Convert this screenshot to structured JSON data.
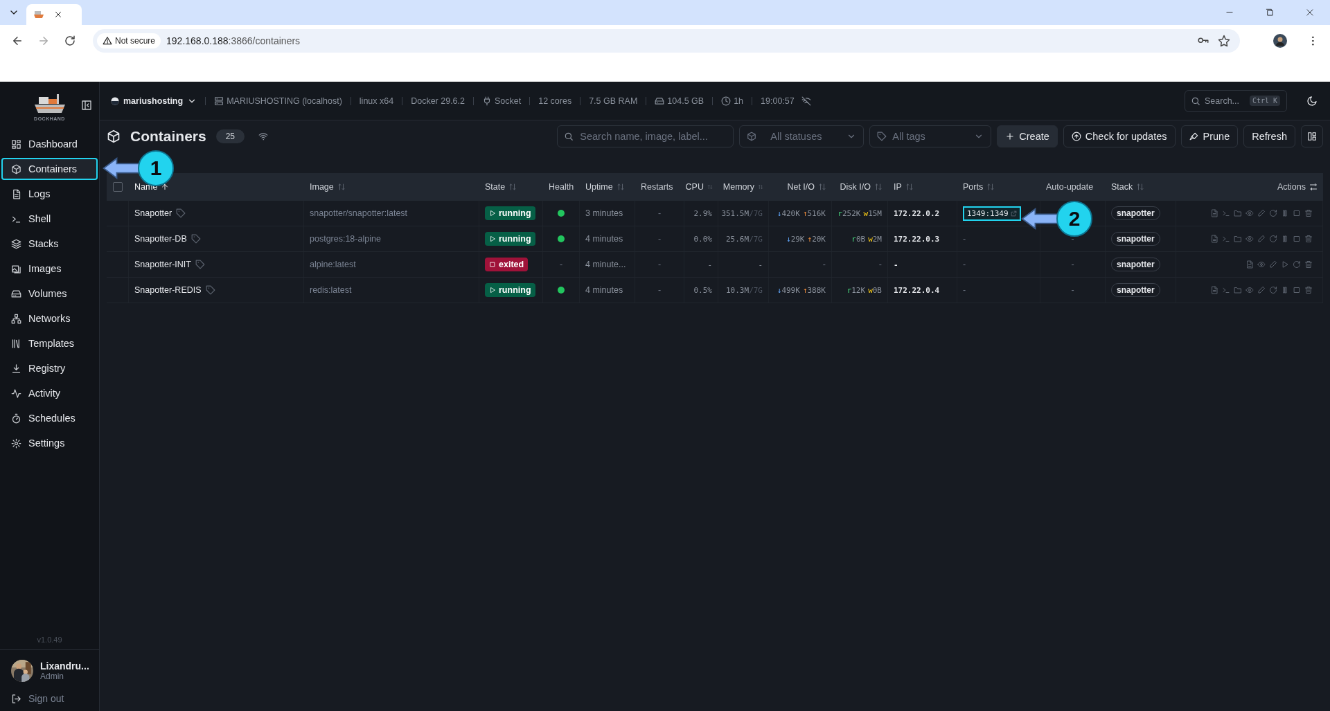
{
  "browser": {
    "tab": {
      "selected": true
    },
    "address": {
      "security": "Not secure",
      "host": "192.168.0.188",
      "path": ":3866/containers"
    }
  },
  "sidebar": {
    "logo_text": "DOCKHAND",
    "items": [
      {
        "label": "Dashboard",
        "kind": "dashboard",
        "selected": false
      },
      {
        "label": "Containers",
        "kind": "containers",
        "selected": true
      },
      {
        "label": "Logs",
        "kind": "logs",
        "selected": false
      },
      {
        "label": "Shell",
        "kind": "shell",
        "selected": false
      },
      {
        "label": "Stacks",
        "kind": "stacks",
        "selected": false
      },
      {
        "label": "Images",
        "kind": "images",
        "selected": false
      },
      {
        "label": "Volumes",
        "kind": "volumes",
        "selected": false
      },
      {
        "label": "Networks",
        "kind": "networks",
        "selected": false
      },
      {
        "label": "Templates",
        "kind": "templates",
        "selected": false
      },
      {
        "label": "Registry",
        "kind": "registry",
        "selected": false
      },
      {
        "label": "Activity",
        "kind": "activity",
        "selected": false
      },
      {
        "label": "Schedules",
        "kind": "schedules",
        "selected": false
      },
      {
        "label": "Settings",
        "kind": "settings",
        "selected": false
      }
    ],
    "version": "v1.0.49",
    "user": {
      "name": "Lixandru...",
      "role": "Admin"
    },
    "sign_out": "Sign out"
  },
  "topbar": {
    "environment": "mariushosting",
    "items": [
      {
        "kind": "server",
        "text": "MARIUSHOSTING (localhost)"
      },
      {
        "kind": "none",
        "text": "linux x64"
      },
      {
        "kind": "none",
        "text": "Docker 29.6.2"
      },
      {
        "kind": "socket",
        "text": "Socket"
      },
      {
        "kind": "none",
        "text": "12 cores"
      },
      {
        "kind": "none",
        "text": "7.5 GB RAM"
      },
      {
        "kind": "disk",
        "text": "104.5 GB"
      },
      {
        "kind": "clock",
        "text": "1h"
      },
      {
        "kind": "none",
        "text": "19:00:57"
      }
    ],
    "search": {
      "placeholder": "Search...",
      "shortcut": "Ctrl K"
    }
  },
  "page": {
    "title": "Containers",
    "count": "25",
    "search": {
      "placeholder": "Search name, image, label..."
    },
    "status_filter": "All statuses",
    "tag_filter": "All tags",
    "buttons": [
      {
        "label": "Create",
        "kind": "create"
      },
      {
        "label": "Check for updates",
        "kind": "updates"
      },
      {
        "label": "Prune",
        "kind": "prune"
      },
      {
        "label": "Refresh",
        "kind": "refresh"
      }
    ]
  },
  "table": {
    "select_all": {
      "checked": false
    },
    "columns": [
      {
        "label": "Name",
        "sortable": true,
        "sorted": true
      },
      {
        "label": "Image",
        "sortable": true,
        "sorted": false
      },
      {
        "label": "State",
        "sortable": true,
        "sorted": false
      },
      {
        "label": "Health",
        "sortable": false,
        "sorted": false
      },
      {
        "label": "Uptime",
        "sortable": true,
        "sorted": false
      },
      {
        "label": "Restarts",
        "sortable": false,
        "sorted": false
      },
      {
        "label": "CPU",
        "sortable": true,
        "sorted": false
      },
      {
        "label": "Memory",
        "sortable": true,
        "sorted": false
      },
      {
        "label": "Net I/O",
        "sortable": true,
        "sorted": false
      },
      {
        "label": "Disk I/O",
        "sortable": true,
        "sorted": false
      },
      {
        "label": "IP",
        "sortable": true,
        "sorted": false
      },
      {
        "label": "Ports",
        "sortable": true,
        "sorted": false
      },
      {
        "label": "Auto-update",
        "sortable": false,
        "sorted": false
      },
      {
        "label": "Stack",
        "sortable": true,
        "sorted": false
      },
      {
        "label": "Actions",
        "sortable": false,
        "sorted": false
      }
    ],
    "rows": [
      {
        "name": "Snapotter",
        "image": "snapotter/snapotter:latest",
        "state": {
          "kind": "running",
          "label": "running"
        },
        "health": {
          "kind": "dot",
          "color": "#22c55e"
        },
        "uptime": "3 minutes",
        "restarts": "-",
        "cpu": "2.9%",
        "memory": {
          "used": "351.5M",
          "total": "/7G"
        },
        "net_in": "↓420K",
        "net_out": "↑516K",
        "disk_read": "r252K",
        "disk_write": "w15M",
        "ip": "172.22.0.2",
        "ports": {
          "text": "1349:1349",
          "link": true,
          "highlighted": true
        },
        "stack": "snapotter",
        "actions": [
          {
            "kind": "logs"
          },
          {
            "kind": "terminal"
          },
          {
            "kind": "files"
          },
          {
            "kind": "inspect"
          },
          {
            "kind": "edit"
          },
          {
            "kind": "restart"
          },
          {
            "kind": "pause"
          },
          {
            "kind": "stop"
          },
          {
            "kind": "delete"
          }
        ]
      },
      {
        "name": "Snapotter-DB",
        "image": "postgres:18-alpine",
        "state": {
          "kind": "running",
          "label": "running"
        },
        "health": {
          "kind": "dot",
          "color": "#22c55e"
        },
        "uptime": "4 minutes",
        "restarts": "-",
        "cpu": "0.0%",
        "memory": {
          "used": "25.6M",
          "total": "/7G"
        },
        "net_in": "↓29K",
        "net_out": "↑20K",
        "disk_read": "r0B",
        "disk_write": "w2M",
        "ip": "172.22.0.3",
        "ports": {
          "text": "-"
        },
        "auto_update": "-",
        "stack": "snapotter",
        "actions": [
          {
            "kind": "logs"
          },
          {
            "kind": "terminal"
          },
          {
            "kind": "files"
          },
          {
            "kind": "inspect"
          },
          {
            "kind": "edit"
          },
          {
            "kind": "restart"
          },
          {
            "kind": "pause"
          },
          {
            "kind": "stop"
          },
          {
            "kind": "delete"
          }
        ]
      },
      {
        "name": "Snapotter-INIT",
        "image": "alpine:latest",
        "state": {
          "kind": "exited",
          "label": "exited"
        },
        "health": {
          "kind": "text",
          "text": "-"
        },
        "uptime": "4 minute...",
        "restarts": "-",
        "cpu": "-",
        "memory": {
          "used": "-"
        },
        "net_io": "-",
        "disk_io": "-",
        "ip": "-",
        "ports": {
          "text": "-"
        },
        "auto_update": "-",
        "stack": "snapotter",
        "actions": [
          {
            "kind": "logs"
          },
          {
            "kind": "inspect"
          },
          {
            "kind": "edit"
          },
          {
            "kind": "start"
          },
          {
            "kind": "restart"
          },
          {
            "kind": "delete"
          }
        ]
      },
      {
        "name": "Snapotter-REDIS",
        "image": "redis:latest",
        "state": {
          "kind": "running",
          "label": "running"
        },
        "health": {
          "kind": "dot",
          "color": "#22c55e"
        },
        "uptime": "4 minutes",
        "restarts": "-",
        "cpu": "0.5%",
        "memory": {
          "used": "10.3M",
          "total": "/7G"
        },
        "net_in": "↓499K",
        "net_out": "↑388K",
        "disk_read": "r12K",
        "disk_write": "w0B",
        "ip": "172.22.0.4",
        "ports": {
          "text": "-"
        },
        "auto_update": "-",
        "stack": "snapotter",
        "actions": [
          {
            "kind": "logs"
          },
          {
            "kind": "terminal"
          },
          {
            "kind": "files"
          },
          {
            "kind": "inspect"
          },
          {
            "kind": "edit"
          },
          {
            "kind": "restart"
          },
          {
            "kind": "pause"
          },
          {
            "kind": "stop"
          },
          {
            "kind": "delete"
          }
        ]
      }
    ]
  },
  "annotations": [
    {
      "number": "1",
      "kind": "sidebar"
    },
    {
      "number": "2",
      "kind": "ports"
    }
  ]
}
